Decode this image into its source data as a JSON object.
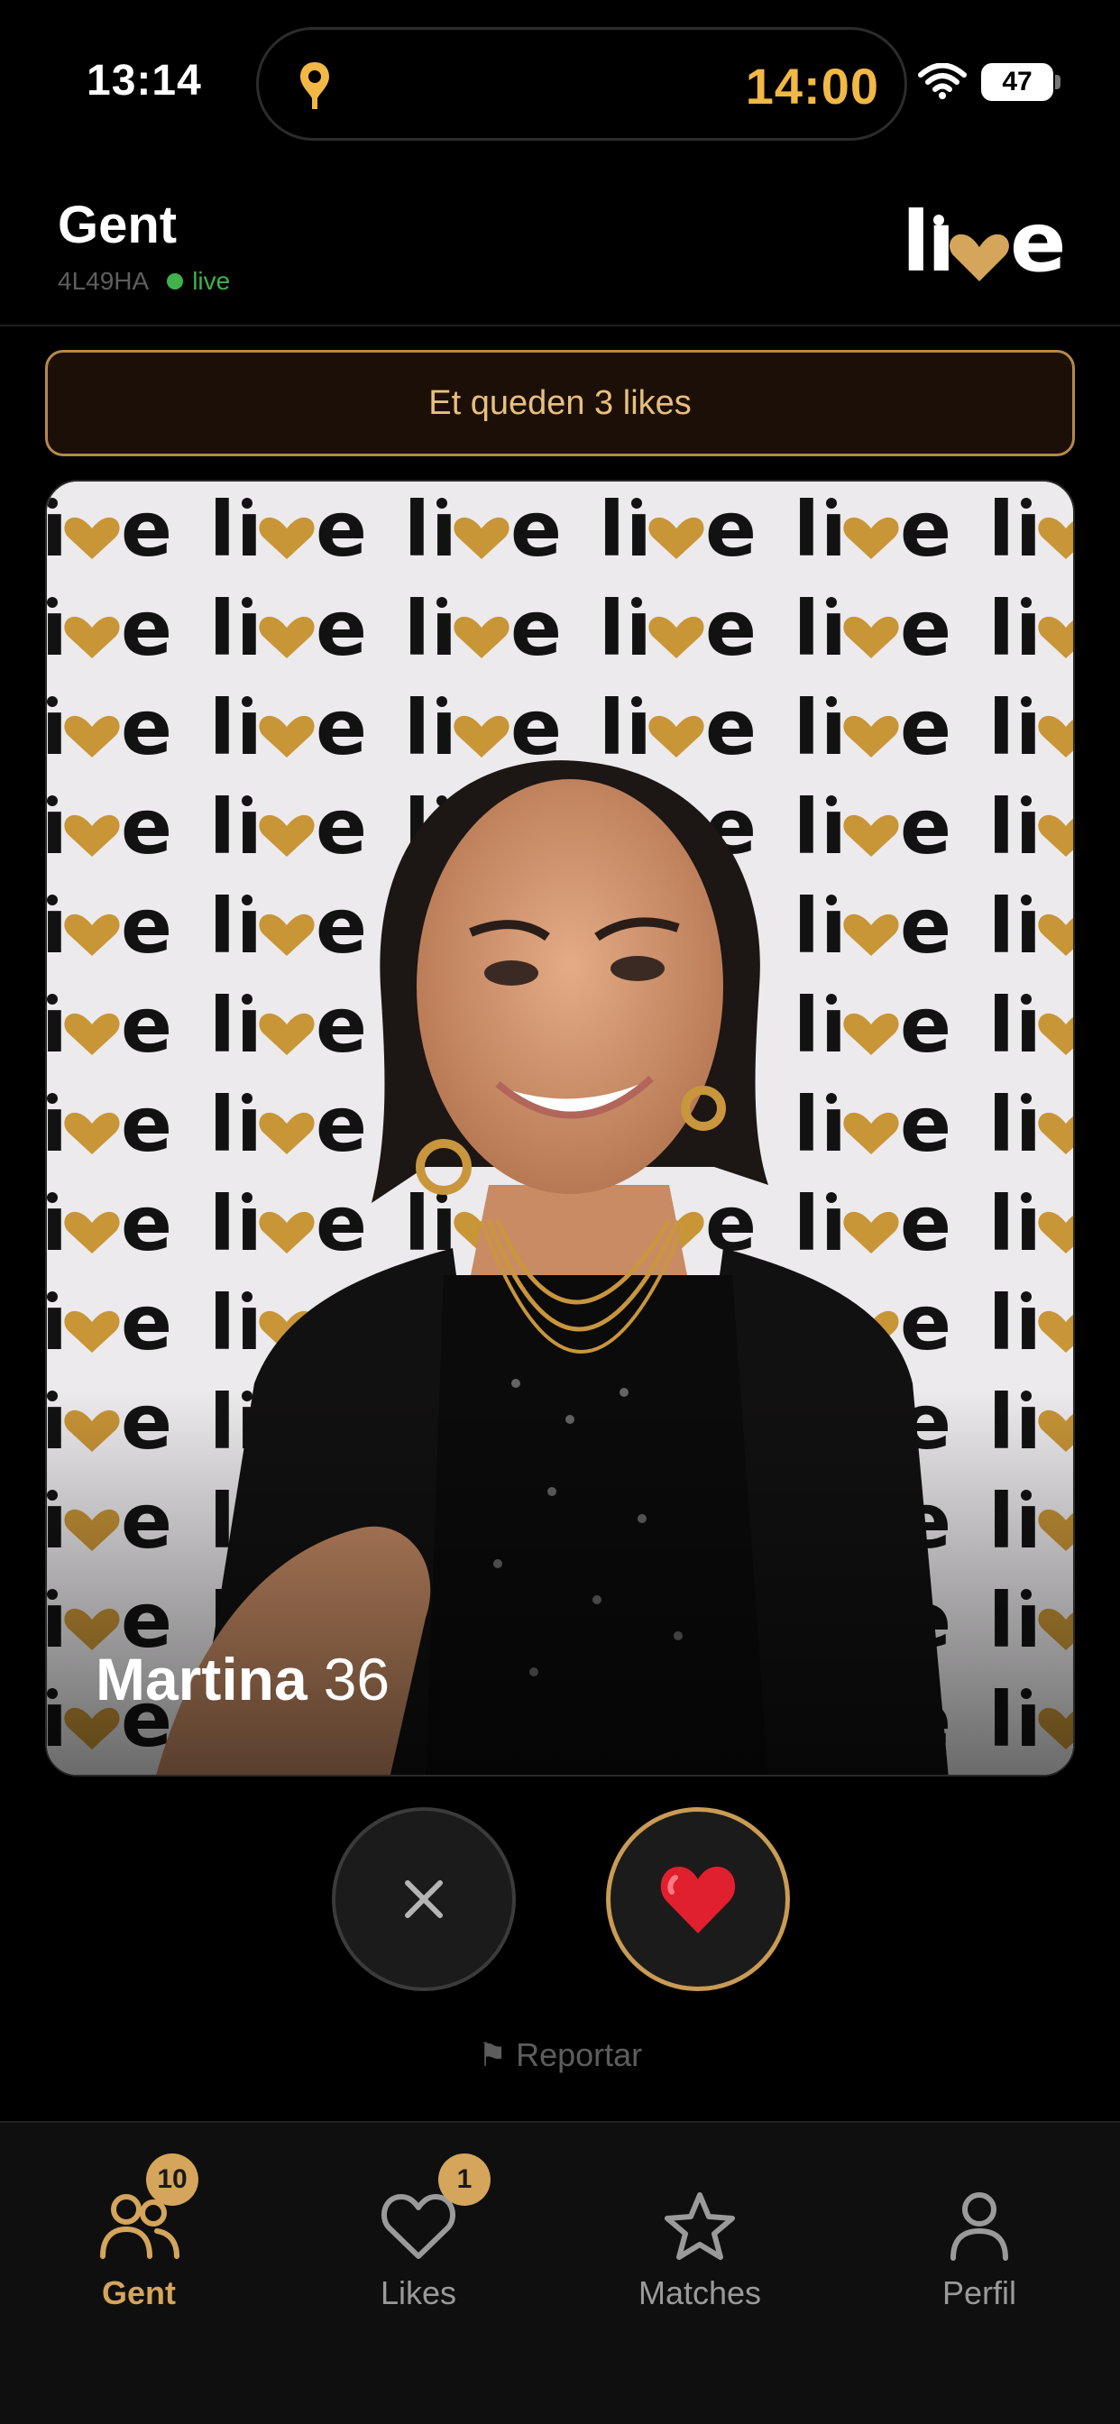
{
  "status_bar": {
    "time": "13:14",
    "island_time": "14:00",
    "battery": "47",
    "pin_color": "#f2b845"
  },
  "header": {
    "title": "Gent",
    "code": "4L49HA",
    "status": "live",
    "logo_text": "live"
  },
  "banner": {
    "text": "Et queden 3 likes"
  },
  "card": {
    "name": "Martina",
    "age": "36",
    "backdrop_text": "live"
  },
  "actions": {
    "pass_icon": "close-icon",
    "like_icon": "heart-icon",
    "report_label": "⚑ Reportar"
  },
  "nav": {
    "items": [
      {
        "label": "Gent",
        "icon": "people-icon",
        "badge": "10",
        "active": true
      },
      {
        "label": "Likes",
        "icon": "heart-outline-icon",
        "badge": "1",
        "active": false
      },
      {
        "label": "Matches",
        "icon": "star-icon",
        "badge": "",
        "active": false
      },
      {
        "label": "Perfil",
        "icon": "person-icon",
        "badge": "",
        "active": false
      }
    ]
  },
  "colors": {
    "accent_gold": "#d4a55b",
    "banner_bg": "#1c0f07",
    "live_green": "#3fb24b",
    "like_red": "#e0202e"
  }
}
